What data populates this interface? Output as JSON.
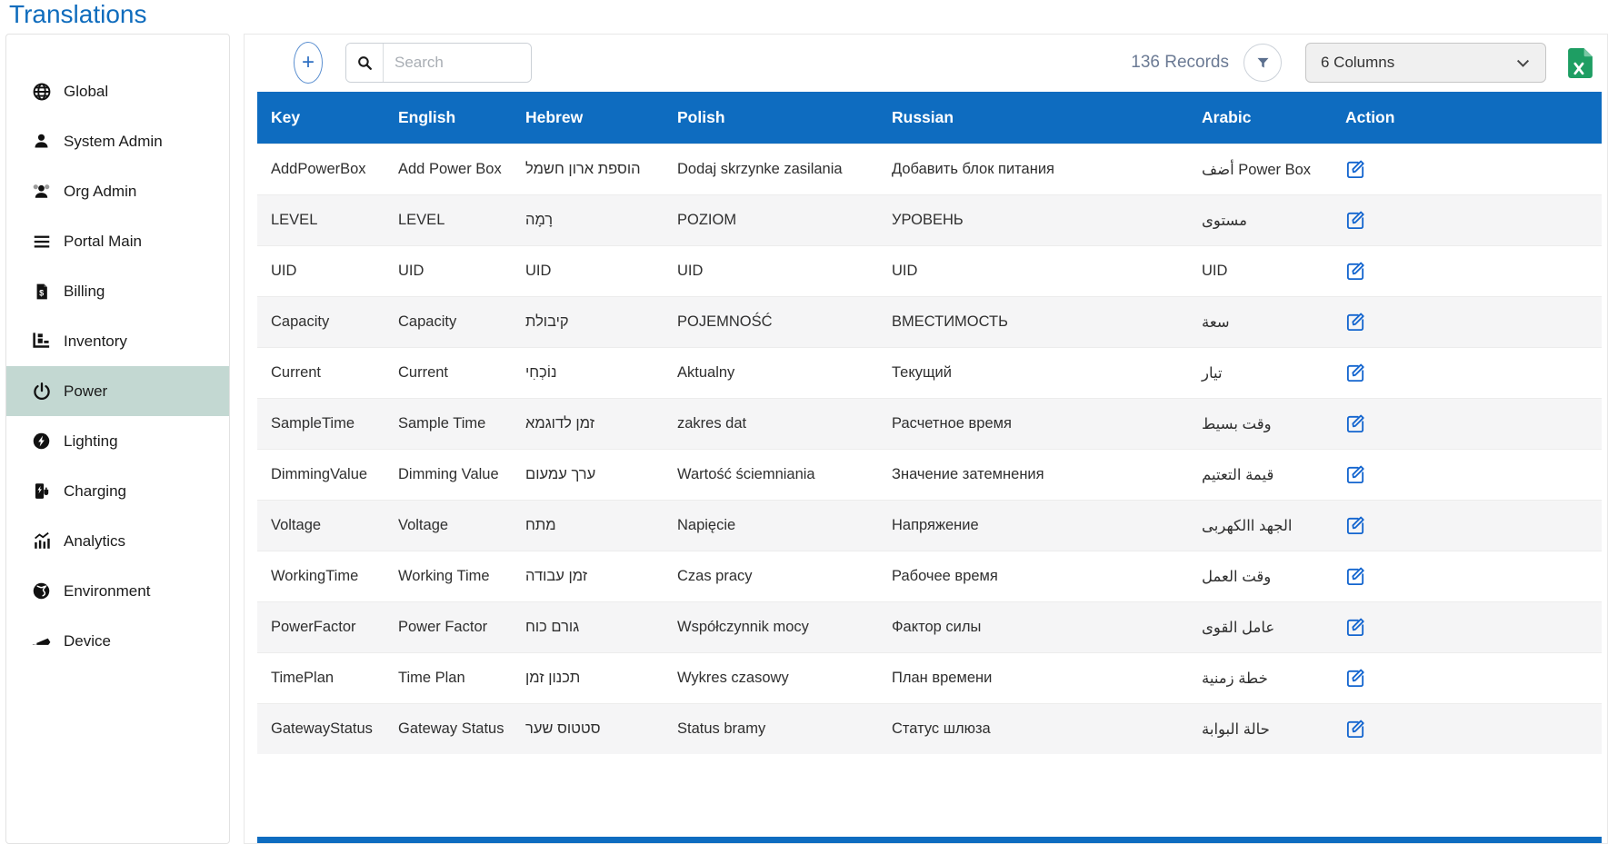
{
  "page": {
    "title": "Translations"
  },
  "sidebar": {
    "items": [
      {
        "label": "Global",
        "icon": "globe-icon",
        "selected": false
      },
      {
        "label": "System Admin",
        "icon": "user-icon",
        "selected": false
      },
      {
        "label": "Org Admin",
        "icon": "users-icon",
        "selected": false
      },
      {
        "label": "Portal Main",
        "icon": "menu-lines-icon",
        "selected": false
      },
      {
        "label": "Billing",
        "icon": "invoice-icon",
        "selected": false
      },
      {
        "label": "Inventory",
        "icon": "inventory-cart-icon",
        "selected": false
      },
      {
        "label": "Power",
        "icon": "power-icon",
        "selected": true
      },
      {
        "label": "Lighting",
        "icon": "lightning-circle-icon",
        "selected": false
      },
      {
        "label": "Charging",
        "icon": "ev-charger-icon",
        "selected": false
      },
      {
        "label": "Analytics",
        "icon": "analytics-chart-icon",
        "selected": false
      },
      {
        "label": "Environment",
        "icon": "environment-globe-icon",
        "selected": false
      },
      {
        "label": "Device",
        "icon": "device-scanner-icon",
        "selected": false
      }
    ]
  },
  "toolbar": {
    "add_button_label": "+",
    "search_placeholder": "Search",
    "records_text": "136 Records",
    "columns_selected": "6 Columns"
  },
  "table": {
    "columns": [
      "Key",
      "English",
      "Hebrew",
      "Polish",
      "Russian",
      "Arabic",
      "Action"
    ],
    "rows": [
      {
        "key": "AddPowerBox",
        "english": "Add Power Box",
        "hebrew": "הוספת ארון חשמל",
        "polish": "Dodaj skrzynke zasilania",
        "russian": "Добавить блок питания",
        "arabic": "أضف Power Box"
      },
      {
        "key": "LEVEL",
        "english": "LEVEL",
        "hebrew": "רָמָה",
        "polish": "POZIOM",
        "russian": "УРОВЕНЬ",
        "arabic": "مستوى"
      },
      {
        "key": "UID",
        "english": "UID",
        "hebrew": "UID",
        "polish": "UID",
        "russian": "UID",
        "arabic": "UID"
      },
      {
        "key": "Capacity",
        "english": "Capacity",
        "hebrew": "קיבולת",
        "polish": "POJEMNOŚĆ",
        "russian": "ВМЕСТИМОСТЬ",
        "arabic": "سعة"
      },
      {
        "key": "Current",
        "english": "Current",
        "hebrew": "נוֹכְחִי",
        "polish": "Aktualny",
        "russian": "Текущий",
        "arabic": "تيار"
      },
      {
        "key": "SampleTime",
        "english": "Sample Time",
        "hebrew": "זמן לדוגמא",
        "polish": "zakres dat",
        "russian": "Расчетное время",
        "arabic": "وقت بسيط"
      },
      {
        "key": "DimmingValue",
        "english": "Dimming Value",
        "hebrew": "ערך עמעום",
        "polish": "Wartość ściemniania",
        "russian": "Значение затемнения",
        "arabic": "قيمة التعتيم"
      },
      {
        "key": "Voltage",
        "english": "Voltage",
        "hebrew": "מתח",
        "polish": "Napięcie",
        "russian": "Напряжение",
        "arabic": "الجهد االكهربى"
      },
      {
        "key": "WorkingTime",
        "english": "Working Time",
        "hebrew": "זמן עבודה",
        "polish": "Czas pracy",
        "russian": "Рабочее время",
        "arabic": "وقت العمل"
      },
      {
        "key": "PowerFactor",
        "english": "Power Factor",
        "hebrew": "גורם כוח",
        "polish": "Współczynnik mocy",
        "russian": "Фактор силы",
        "arabic": "عامل القوى"
      },
      {
        "key": "TimePlan",
        "english": "Time Plan",
        "hebrew": "תכנון זמן",
        "polish": "Wykres czasowy",
        "russian": "План времени",
        "arabic": "خطة زمنية"
      },
      {
        "key": "GatewayStatus",
        "english": "Gateway Status",
        "hebrew": "סטטוס שער",
        "polish": "Status bramy",
        "russian": "Статус шлюза",
        "arabic": "حالة البوابة"
      }
    ]
  },
  "colors": {
    "header_blue": "#0e6cc0",
    "title_blue": "#0f6cbd",
    "selected_sidebar_bg": "#c3d8d2",
    "records_text": "#6b7a94",
    "excel_green": "#1e9e63",
    "edit_icon_blue": "#1365cf"
  }
}
